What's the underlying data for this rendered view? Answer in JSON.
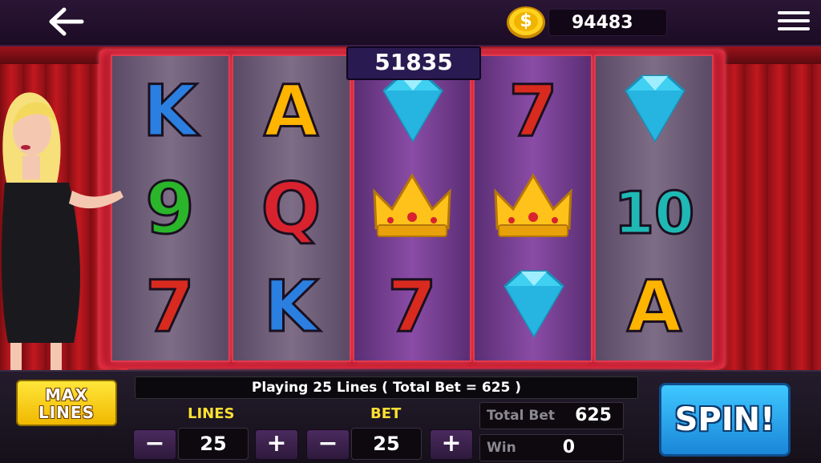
{
  "header": {
    "balance": "94483",
    "back_icon": "arrow-left-icon",
    "menu_icon": "hamburger-menu-icon",
    "coin_icon": "gold-coin-icon",
    "coin_symbol": "$"
  },
  "jackpot": "51835",
  "reels": [
    [
      "K",
      "9",
      "7"
    ],
    [
      "A",
      "Q",
      "K"
    ],
    [
      "diamond",
      "crown",
      "7"
    ],
    [
      "7",
      "crown",
      "diamond"
    ],
    [
      "diamond",
      "10",
      "A"
    ]
  ],
  "controls": {
    "max_lines_label": "MAX LINES",
    "max_lines_line1": "MAX",
    "max_lines_line2": "LINES",
    "info_text": "Playing 25 Lines ( Total Bet = 625 )",
    "lines_label": "LINES",
    "lines_value": "25",
    "bet_label": "BET",
    "bet_value": "25",
    "minus": "−",
    "plus": "+",
    "total_bet_label": "Total Bet",
    "total_bet_value": "625",
    "win_label": "Win",
    "win_value": "0",
    "spin_label": "SPIN!"
  },
  "colors": {
    "gold": "#ffe033",
    "spin_blue": "#29a8f0",
    "frame_red": "#b2182a"
  }
}
